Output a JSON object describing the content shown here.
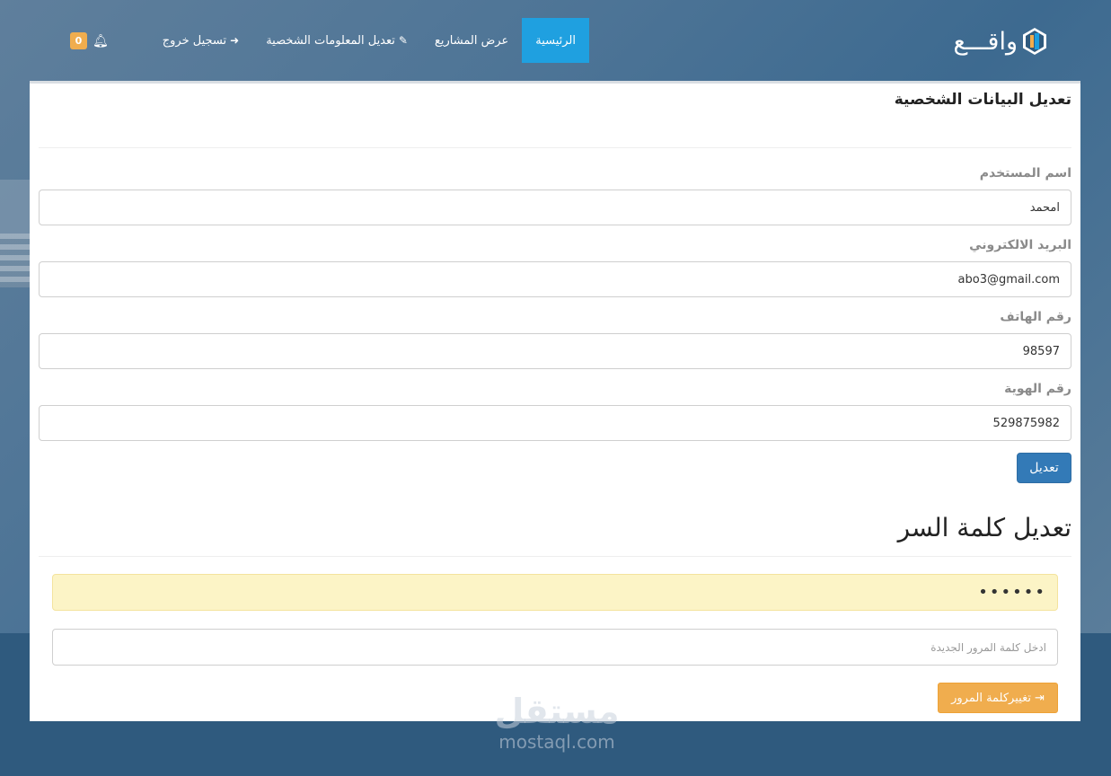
{
  "brand": {
    "logo_text": "واقـــع"
  },
  "nav": {
    "items": [
      {
        "label": "الرئيسية",
        "active": true
      },
      {
        "label": "عرض المشاريع",
        "active": false
      },
      {
        "label": "تعديل المعلومات الشخصية",
        "icon": "edit-icon",
        "active": false
      },
      {
        "label": "تسجيل خروج",
        "icon": "sign-out-icon",
        "active": false
      }
    ],
    "notifications_count": "0",
    "bell_icon": "bell-icon"
  },
  "profile": {
    "title": "تعديل البيانات الشخصية",
    "fields": [
      {
        "label": "اسم المستخدم",
        "value": "امحمد"
      },
      {
        "label": "البريد الالكتروني",
        "value": "abo3@gmail.com"
      },
      {
        "label": "رقم الهاتف",
        "value": "98597"
      },
      {
        "label": "رقم الهوية",
        "value": "529875982"
      }
    ],
    "submit_label": "تعديل"
  },
  "password": {
    "title": "تعديل كلمة السر",
    "current_value": "••••••",
    "new_placeholder": "ادخل كلمة المرور الجديدة",
    "submit_label": "تغييركلمة المرور",
    "submit_icon": "sign-in-icon"
  },
  "watermark": {
    "arabic": "مستقل",
    "latin": "mostaql.com"
  },
  "colors": {
    "nav_active": "#1fa0e0",
    "primary_button": "#337ab7",
    "warning_button": "#f0ad4e",
    "highlight_field": "#fcf4c6"
  }
}
